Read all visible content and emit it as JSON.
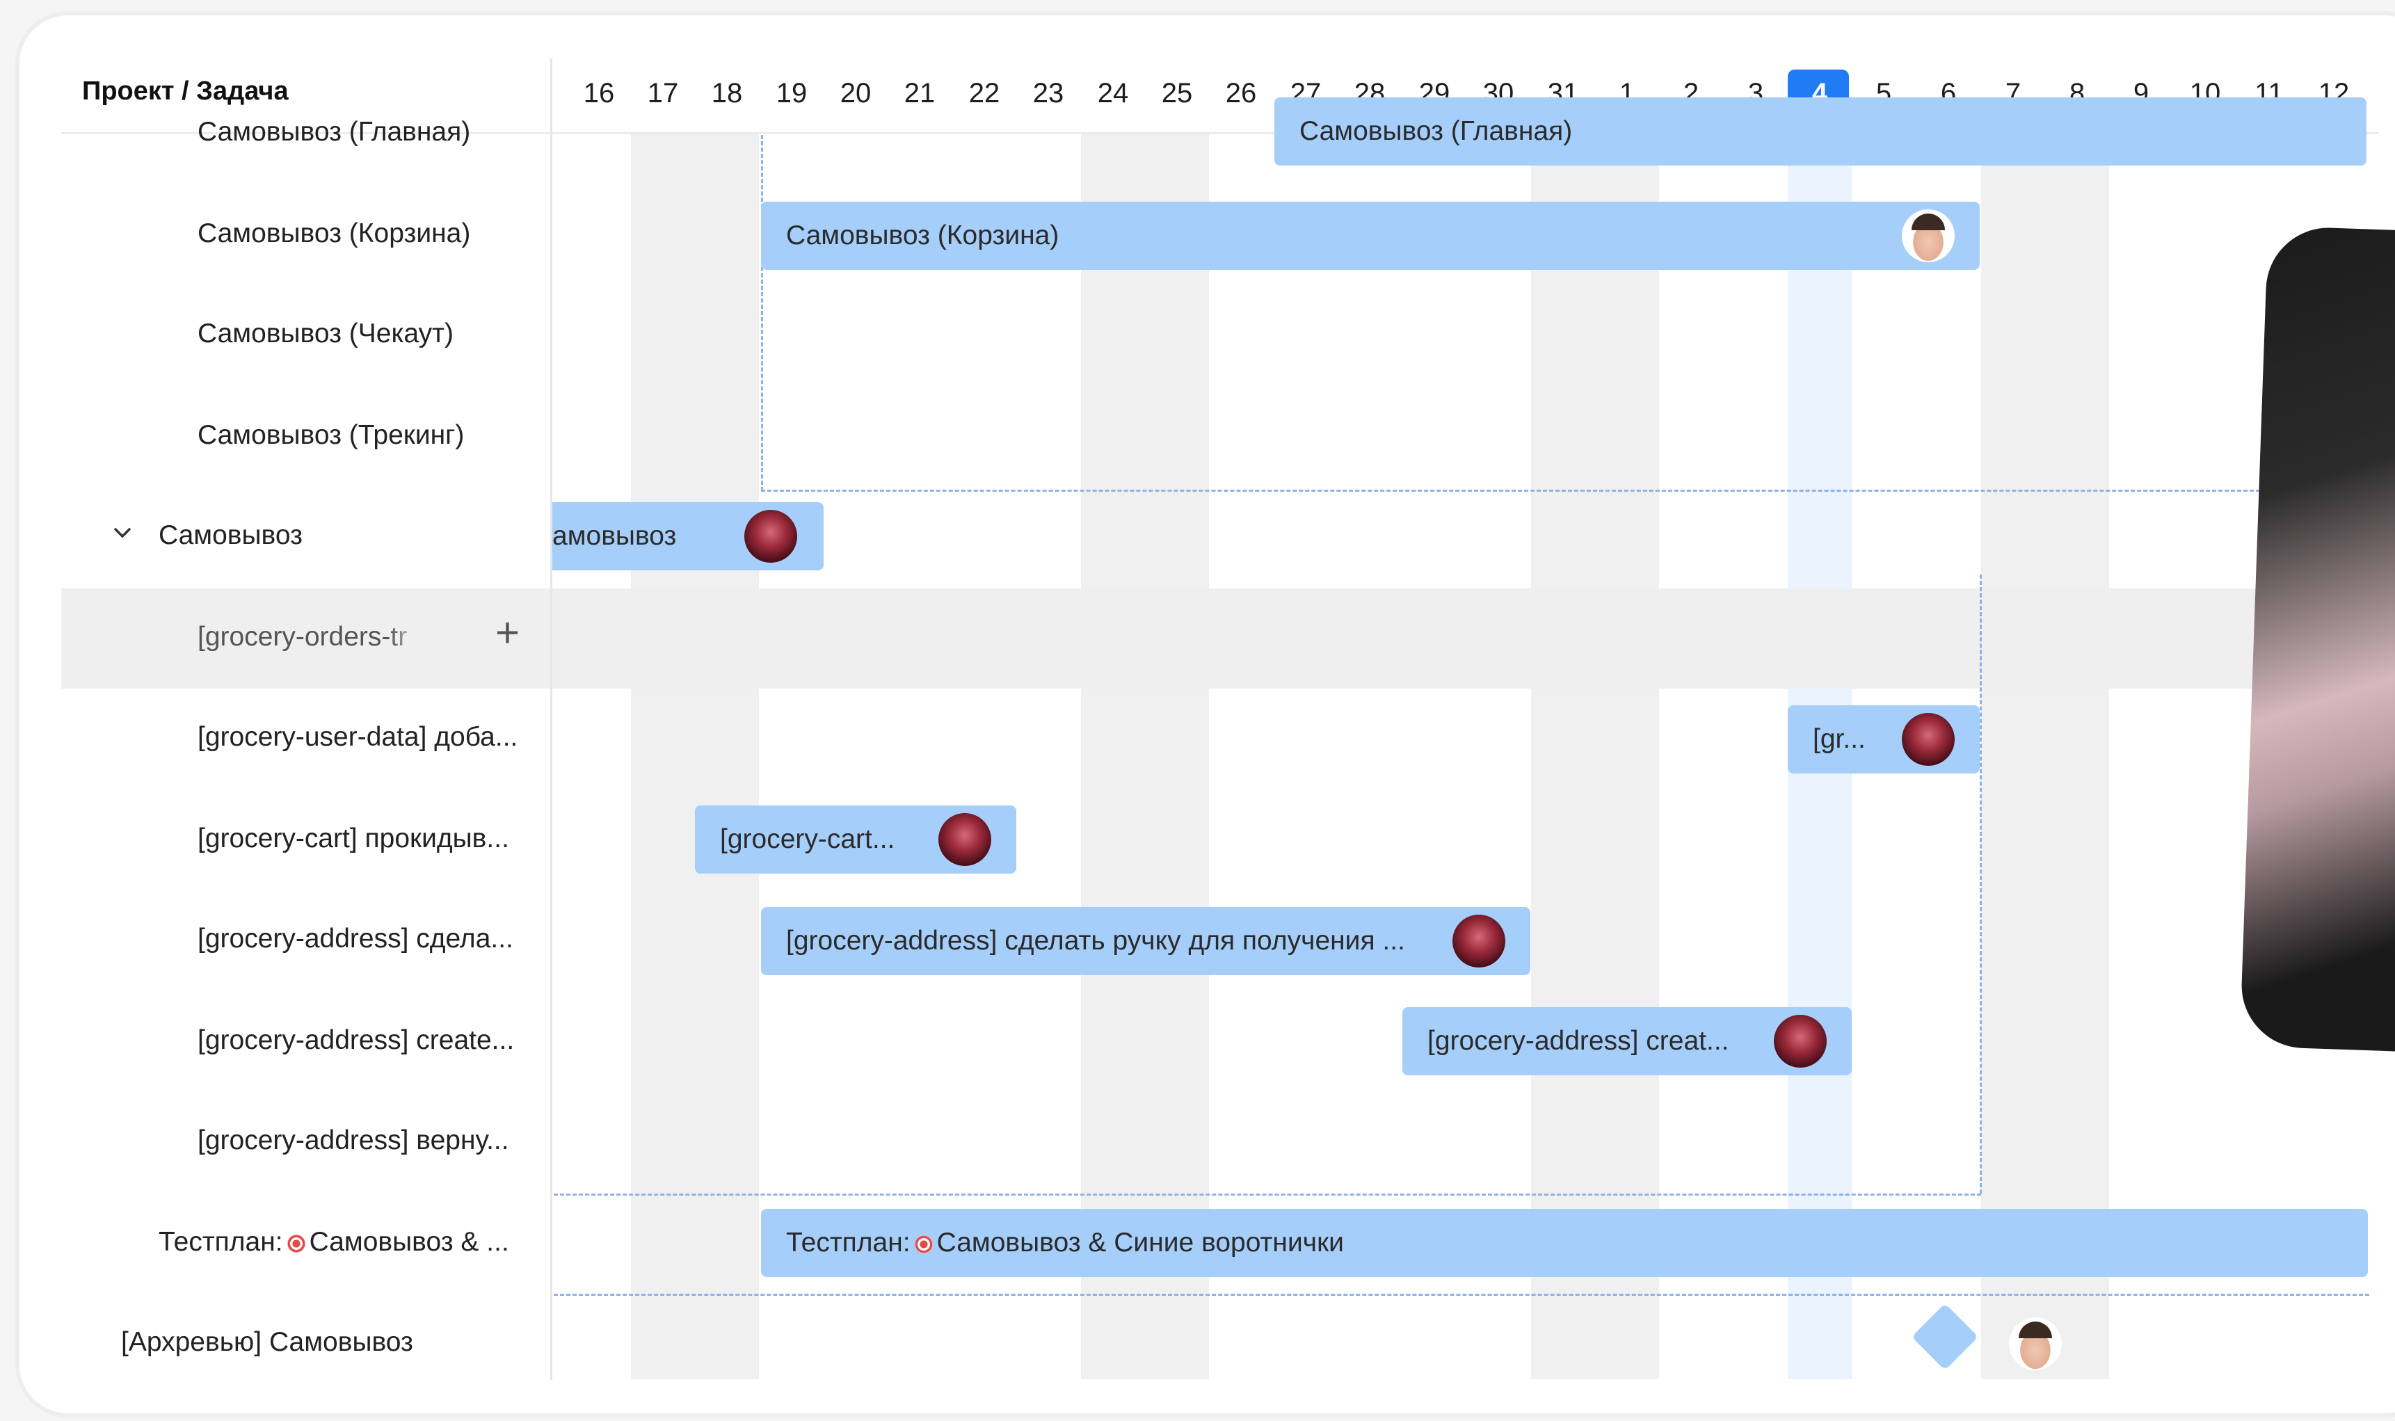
{
  "header": {
    "project_task_label": "Проект / Задача",
    "days": [
      "16",
      "17",
      "18",
      "19",
      "20",
      "21",
      "22",
      "23",
      "24",
      "25",
      "26",
      "27",
      "28",
      "29",
      "30",
      "31",
      "1",
      "2",
      "3",
      "4",
      "5",
      "6",
      "7",
      "8",
      "9",
      "10",
      "11",
      "12"
    ],
    "today": "4"
  },
  "tasks": [
    "Самовывоз (Главная)",
    "Самовывоз (Корзина)",
    "Самовывоз (Чекаут)",
    "Самовывоз (Трекинг)",
    "Самовывоз",
    "[grocery-orders-tr",
    "[grocery-user-data] доба...",
    "[grocery-cart] прокидыв...",
    "[grocery-address] сдела...",
    "[grocery-address] create...",
    "[grocery-address] верну...",
    "Тестплан:",
    "Самовывоз & ...",
    "[Архревью] Самовывоз"
  ],
  "bars": [
    "Самовывоз (Главная)",
    "Самовывоз (Корзина)",
    "амовывоз",
    "[gr...",
    "[grocery-cart...",
    "[grocery-address] сделать ручку для получения ...",
    "[grocery-address] creat...",
    "Тестплан:",
    "Самовывоз & Синие воротнички"
  ],
  "colors": {
    "accent": "#1f7cf5",
    "bar": "#a6cefa",
    "today_column": "#eaf3ff",
    "weekend_column": "#f0f0f0"
  }
}
